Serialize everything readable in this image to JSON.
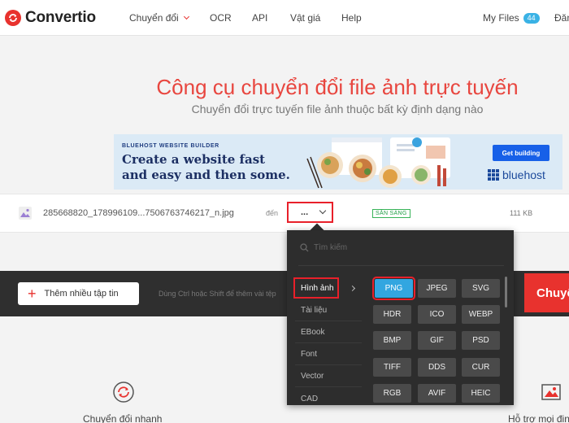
{
  "header": {
    "brand": "Convertio",
    "nav": {
      "convert": "Chuyển đổi",
      "ocr": "OCR",
      "api": "API",
      "pricing": "Vật giá",
      "help": "Help",
      "my_files": "My Files",
      "my_files_count": "44",
      "login": "Đăn"
    }
  },
  "hero": {
    "title": "Công cụ chuyển đổi file ảnh trực tuyến",
    "subtitle": "Chuyển đổi trực tuyến file ảnh thuộc bất kỳ định dạng nào"
  },
  "ad": {
    "small": "BLUEHOST WEBSITE BUILDER",
    "line1": "Create a website fast",
    "line2": "and easy and then some.",
    "cta": "Get building",
    "brand": "bluehost"
  },
  "file": {
    "name": "285668820_178996109...7506763746217_n.jpg",
    "to_label": "đến",
    "selected_format": "...",
    "status": "SẴN SÀNG",
    "size": "111 KB"
  },
  "actions": {
    "add_files": "Thêm nhiều tập tin",
    "hint": "Dùng Ctrl hoặc Shift để thêm vài tệp",
    "convert": "Chuyển"
  },
  "dropdown": {
    "search_placeholder": "Tìm kiếm",
    "categories": [
      "Hình ảnh",
      "Tài liệu",
      "EBook",
      "Font",
      "Vector",
      "CAD"
    ],
    "active_category": "Hình ảnh",
    "formats": [
      "PNG",
      "JPEG",
      "SVG",
      "HDR",
      "ICO",
      "WEBP",
      "BMP",
      "GIF",
      "PSD",
      "TIFF",
      "DDS",
      "CUR",
      "RGB",
      "AVIF",
      "HEIC"
    ],
    "selected_format": "PNG"
  },
  "features": {
    "fast": "Chuyển đổi nhanh",
    "support": "Hỗ trợ mọi định"
  },
  "colors": {
    "accent": "#e8322e",
    "dropdown_bg": "#2d2d2d",
    "selected_format": "#32a6e0",
    "status_green": "#1f9e45"
  }
}
